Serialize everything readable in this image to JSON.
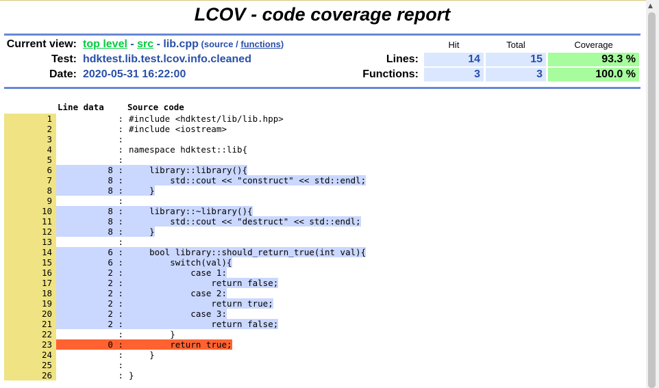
{
  "title": "LCOV - code coverage report",
  "header": {
    "current_view_label": "Current view:",
    "crumb_top": "top level",
    "sep1": " - ",
    "crumb_src": "src",
    "sep2": " - ",
    "file": "lib.cpp",
    "paren_open": " (",
    "source_word": "source",
    "slash": " / ",
    "functions_link": "functions",
    "paren_close": ")",
    "test_label": "Test:",
    "test_value": "hdktest.lib.test.lcov.info.cleaned",
    "date_label": "Date:",
    "date_value": "2020-05-31 16:22:00"
  },
  "summary": {
    "col_hit": "Hit",
    "col_total": "Total",
    "col_coverage": "Coverage",
    "lines_label": "Lines:",
    "lines_hit": "14",
    "lines_total": "15",
    "lines_cov": "93.3 %",
    "functions_label": "Functions:",
    "functions_hit": "3",
    "functions_total": "3",
    "functions_cov": "100.0 %"
  },
  "source": {
    "col_linedata": "Line data",
    "col_source": "Source code",
    "lines": [
      {
        "n": "1",
        "d": " :",
        "s": "#include <hdktest/lib/lib.hpp>",
        "c": "none"
      },
      {
        "n": "2",
        "d": " :",
        "s": "#include <iostream>",
        "c": "none"
      },
      {
        "n": "3",
        "d": " :",
        "s": "",
        "c": "none"
      },
      {
        "n": "4",
        "d": " :",
        "s": "namespace hdktest::lib{",
        "c": "none"
      },
      {
        "n": "5",
        "d": " :",
        "s": "",
        "c": "none"
      },
      {
        "n": "6",
        "d": "8 :",
        "s": "    library::library(){",
        "c": "cov"
      },
      {
        "n": "7",
        "d": "8 :",
        "s": "        std::cout << \"construct\" << std::endl;",
        "c": "cov"
      },
      {
        "n": "8",
        "d": "8 :",
        "s": "    }",
        "c": "cov"
      },
      {
        "n": "9",
        "d": " :",
        "s": "",
        "c": "none"
      },
      {
        "n": "10",
        "d": "8 :",
        "s": "    library::~library(){",
        "c": "cov"
      },
      {
        "n": "11",
        "d": "8 :",
        "s": "        std::cout << \"destruct\" << std::endl;",
        "c": "cov"
      },
      {
        "n": "12",
        "d": "8 :",
        "s": "    }",
        "c": "cov"
      },
      {
        "n": "13",
        "d": " :",
        "s": "",
        "c": "none"
      },
      {
        "n": "14",
        "d": "6 :",
        "s": "    bool library::should_return_true(int val){",
        "c": "cov"
      },
      {
        "n": "15",
        "d": "6 :",
        "s": "        switch(val){",
        "c": "cov"
      },
      {
        "n": "16",
        "d": "2 :",
        "s": "            case 1:",
        "c": "cov"
      },
      {
        "n": "17",
        "d": "2 :",
        "s": "                return false;",
        "c": "cov"
      },
      {
        "n": "18",
        "d": "2 :",
        "s": "            case 2:",
        "c": "cov"
      },
      {
        "n": "19",
        "d": "2 :",
        "s": "                return true;",
        "c": "cov"
      },
      {
        "n": "20",
        "d": "2 :",
        "s": "            case 3:",
        "c": "cov"
      },
      {
        "n": "21",
        "d": "2 :",
        "s": "                return false;",
        "c": "cov"
      },
      {
        "n": "22",
        "d": " :",
        "s": "        }",
        "c": "none"
      },
      {
        "n": "23",
        "d": "0 :",
        "s": "        return true;",
        "c": "unc"
      },
      {
        "n": "24",
        "d": " :",
        "s": "    }",
        "c": "none"
      },
      {
        "n": "25",
        "d": " :",
        "s": "",
        "c": "none"
      },
      {
        "n": "26",
        "d": " :",
        "s": "}",
        "c": "none"
      }
    ]
  },
  "colors": {
    "covered": "#cad7fe",
    "uncovered": "#ff6230",
    "lineno_bg": "#efe383",
    "link_green": "#00cb40",
    "value_blue": "#284fa8"
  },
  "icons": {
    "scroll_up": "scroll-up-arrow-icon"
  }
}
